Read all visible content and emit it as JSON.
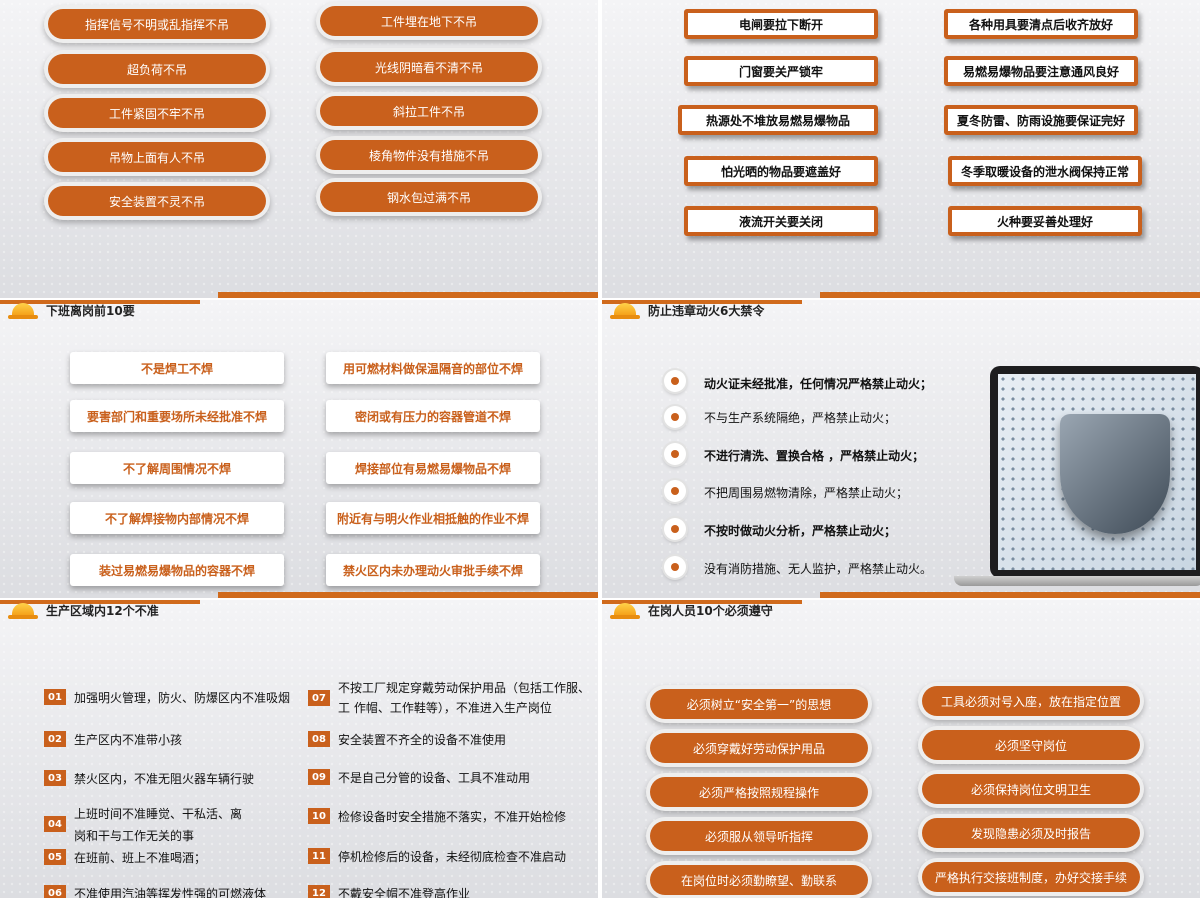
{
  "slide1": {
    "left": [
      "指挥信号不明或乱指挥不吊",
      "超负荷不吊",
      "工件紧固不牢不吊",
      "吊物上面有人不吊",
      "安全装置不灵不吊"
    ],
    "right": [
      "工件埋在地下不吊",
      "光线阴暗看不清不吊",
      "斜拉工件不吊",
      "棱角物件没有措施不吊",
      "钢水包过满不吊"
    ]
  },
  "slide2": {
    "left": [
      "电闸要拉下断开",
      "门窗要关严锁牢",
      "热源处不堆放易燃易爆物品",
      "怕光晒的物品要遮盖好",
      "液流开关要关闭"
    ],
    "right": [
      "各种用具要清点后收齐放好",
      "易燃易爆物品要注意通风良好",
      "夏冬防雷、防雨设施要保证完好",
      "冬季取暖设备的泄水阀保持正常",
      "火种要妥善处理好"
    ]
  },
  "slide3": {
    "title": "下班离岗前10要",
    "left": [
      "不是焊工不焊",
      "要害部门和重要场所未经批准不焊",
      "不了解周围情况不焊",
      "不了解焊接物内部情况不焊",
      "装过易燃易爆物品的容器不焊"
    ],
    "right": [
      "用可燃材料做保温隔音的部位不焊",
      "密闭或有压力的容器管道不焊",
      "焊接部位有易燃易爆物品不焊",
      "附近有与明火作业相抵触的作业不焊",
      "禁火区内未办理动火审批手续不焊"
    ]
  },
  "slide4": {
    "title": "防止违章动火6大禁令",
    "rules": [
      "动火证未经批准，任何情况严格禁止动火；",
      "不与生产系统隔绝，严格禁止动火；",
      "不进行清洗、置换合格  ，严格禁止动火；",
      "不把周围易燃物清除，严格禁止动火；",
      "不按时做动火分析，严格禁止动火；",
      "没有消防措施、无人监护，严格禁止动火。"
    ]
  },
  "slide5": {
    "title": "生产区域内12个不准",
    "left": [
      {
        "num": "01",
        "text": "加强明火管理，防火、防爆区内不准吸烟"
      },
      {
        "num": "02",
        "text": "生产区内不准带小孩"
      },
      {
        "num": "03",
        "text": "禁火区内，不准无阻火器车辆行驶"
      },
      {
        "num": "04",
        "text": "上班时间不准睡觉、干私活、离\n岗和干与工作无关的事"
      },
      {
        "num": "05",
        "text": "在班前、班上不准喝酒；"
      },
      {
        "num": "06",
        "text": "不准使用汽油等挥发性强的可燃液体"
      }
    ],
    "right": [
      {
        "num": "07",
        "text": "不按工厂规定穿戴劳动保护用品（包括工作服、\n工  作帽、工作鞋等），不准进入生产岗位"
      },
      {
        "num": "08",
        "text": "安全装置不齐全的设备不准使用"
      },
      {
        "num": "09",
        "text": "不是自己分管的设备、工具不准动用"
      },
      {
        "num": "10",
        "text": "检修设备时安全措施不落实，不准开始检修"
      },
      {
        "num": "11",
        "text": "停机检修后的设备，未经彻底检查不准启动"
      },
      {
        "num": "12",
        "text": "不戴安全帽不准登高作业"
      }
    ]
  },
  "slide6": {
    "title": "在岗人员10个必须遵守",
    "left": [
      "必须树立“安全第一”的思想",
      "必须穿戴好劳动保护用品",
      "必须严格按照规程操作",
      "必须服从领导听指挥",
      "在岗位时必须勤瞭望、勤联系"
    ],
    "right": [
      "工具必须对号入座，放在指定位置",
      "必须坚守岗位",
      "必须保持岗位文明卫生",
      "发现隐患必须及时报告",
      "严格执行交接班制度，办好交接手续"
    ]
  },
  "colors": {
    "accent": "#c9601c"
  }
}
